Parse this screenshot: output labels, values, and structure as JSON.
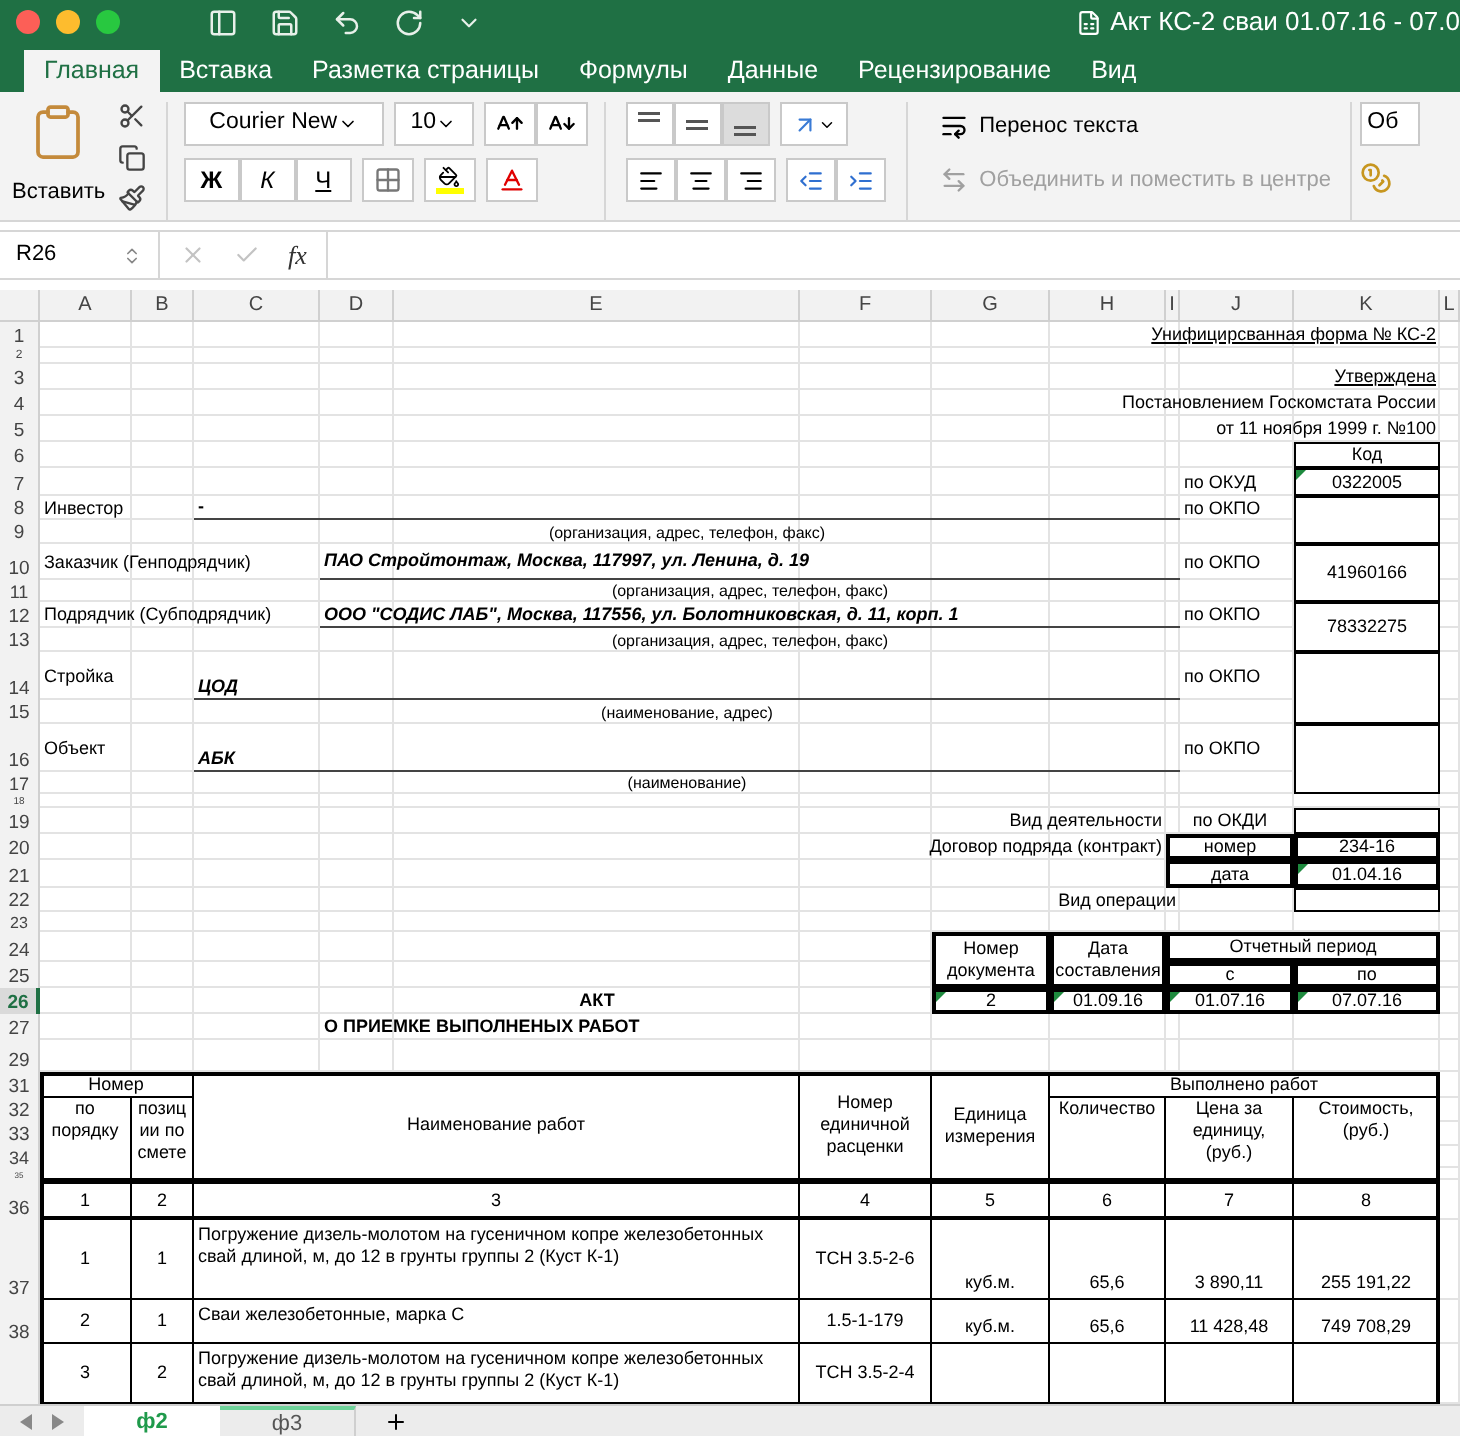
{
  "window": {
    "title": "Акт КС-2 сваи 01.07.16 - 07.0"
  },
  "ribbon_tabs": [
    {
      "label": "Главная",
      "selected": true
    },
    {
      "label": "Вставка",
      "selected": false
    },
    {
      "label": "Разметка страницы",
      "selected": false
    },
    {
      "label": "Формулы",
      "selected": false
    },
    {
      "label": "Данные",
      "selected": false
    },
    {
      "label": "Рецензирование",
      "selected": false
    },
    {
      "label": "Вид",
      "selected": false
    }
  ],
  "ribbon": {
    "paste": "Вставить",
    "font_name": "Courier New",
    "font_size": "10",
    "bold": "Ж",
    "italic": "К",
    "underline": "Ч",
    "wrap_text": {
      "label": "Перенос текста",
      "disabled": false
    },
    "merge_center": {
      "label": "Объединить и поместить в центре",
      "disabled": true
    },
    "number_format": "Об"
  },
  "formula_bar": {
    "name_box": "R26",
    "function_label": "fx"
  },
  "columns": [
    "A",
    "B",
    "C",
    "D",
    "E",
    "F",
    "G",
    "H",
    "I",
    "J",
    "K",
    "L"
  ],
  "rows": [
    {
      "label": "1",
      "selected": false
    },
    {
      "label": "2",
      "selected": false
    },
    {
      "label": "3",
      "selected": false
    },
    {
      "label": "4",
      "selected": false
    },
    {
      "label": "5",
      "selected": false
    },
    {
      "label": "6",
      "selected": false
    },
    {
      "label": "7",
      "selected": false
    },
    {
      "label": "8",
      "selected": false
    },
    {
      "label": "9",
      "selected": false
    },
    {
      "label": "10",
      "selected": false
    },
    {
      "label": "11",
      "selected": false
    },
    {
      "label": "12",
      "selected": false
    },
    {
      "label": "13",
      "selected": false
    },
    {
      "label": "14",
      "selected": false
    },
    {
      "label": "15",
      "selected": false
    },
    {
      "label": "16",
      "selected": false
    },
    {
      "label": "17",
      "selected": false
    },
    {
      "label": "18",
      "selected": false
    },
    {
      "label": "19",
      "selected": false
    },
    {
      "label": "20",
      "selected": false
    },
    {
      "label": "21",
      "selected": false
    },
    {
      "label": "22",
      "selected": false
    },
    {
      "label": "23",
      "selected": false
    },
    {
      "label": "24",
      "selected": false
    },
    {
      "label": "25",
      "selected": false
    },
    {
      "label": "26",
      "selected": true
    },
    {
      "label": "27",
      "selected": false
    },
    {
      "label": "29",
      "selected": false
    },
    {
      "label": "31",
      "selected": false
    },
    {
      "label": "32",
      "selected": false
    },
    {
      "label": "33",
      "selected": false
    },
    {
      "label": "34",
      "selected": false
    },
    {
      "label": "35",
      "selected": false
    },
    {
      "label": "36",
      "selected": false
    },
    {
      "label": "37",
      "selected": false
    },
    {
      "label": "38",
      "selected": false
    }
  ],
  "form_cells": [
    "Унифицирсванная форма № КС-2",
    "Утверждена",
    "Постановлением Госкомстата России",
    "от 11 ноября 1999 г. №100",
    "Код",
    "по ОКУД",
    "0322005",
    "Инвестор",
    "-",
    "по ОКПО",
    "(организация, адрес, телефон, факс)",
    "Заказчик (Генподрядчик)",
    "ПАО Стройтонтаж, Москва, 117997, ул. Ленина, д. 19",
    "по ОКПО",
    "41960166",
    "(организация, адрес, телефон, факс)",
    "Подрядчик (Субподрядчик)",
    "ООО \"СОДИС ЛАБ\", Москва, 117556, ул. Болотниковская, д. 11, корп. 1",
    "по ОКПО",
    "78332275",
    "(организация, адрес, телефон, факс)",
    "Стройка",
    "ЦОД",
    "по ОКПО",
    "(наименование, адрес)",
    "Объект",
    "АБК",
    "по ОКПО",
    "(наименование)",
    "Вид деятельности",
    "по ОКДИ",
    "Договор подряда (контракт)",
    "номер",
    "234-16",
    "дата",
    "01.04.16",
    "Вид операции",
    "Номер документа",
    "Дата составления",
    "Отчетный период",
    "с",
    "по",
    "АКТ",
    "2",
    "01.09.16",
    "01.07.16",
    "07.07.16",
    "О ПРИЕМКЕ ВЫПОЛНЕНЫХ РАБОТ"
  ],
  "work_table": {
    "header_cells": [
      "Номер",
      "по порядку",
      "позиции по смете",
      "Наименование работ",
      "Номер единичной расценки",
      "Единица измерения",
      "Выполнено работ",
      "Количество",
      "Цена за единицу, (руб.)",
      "Стоимость, (руб.)"
    ],
    "column_numbers": [
      "1",
      "2",
      "3",
      "4",
      "5",
      "6",
      "7",
      "8"
    ],
    "rows": [
      {
        "cells": [
          "1",
          "1",
          "Погружение дизель-молотом на гусеничном копре железобетонных свай длиной, м, до 12 в грунты группы 2 (Куст К-1)",
          "ТСН 3.5-2-6",
          "куб.м.",
          "65,6",
          "3 890,11",
          "255 191,22"
        ]
      },
      {
        "cells": [
          "2",
          "1",
          "Сваи железобетонные, марка С",
          "1.5-1-179",
          "куб.м.",
          "65,6",
          "11 428,48",
          "749 708,29"
        ]
      },
      {
        "cells": [
          "3",
          "2",
          "Погружение дизель-молотом на гусеничном копре железобетонных свай длиной, м, до 12 в грунты группы 2 (Куст К-1)",
          "ТСН 3.5-2-4"
        ]
      }
    ]
  },
  "sheet_tabs": [
    {
      "label": "ф2",
      "selected": true
    },
    {
      "label": "ф3",
      "selected": false
    }
  ]
}
